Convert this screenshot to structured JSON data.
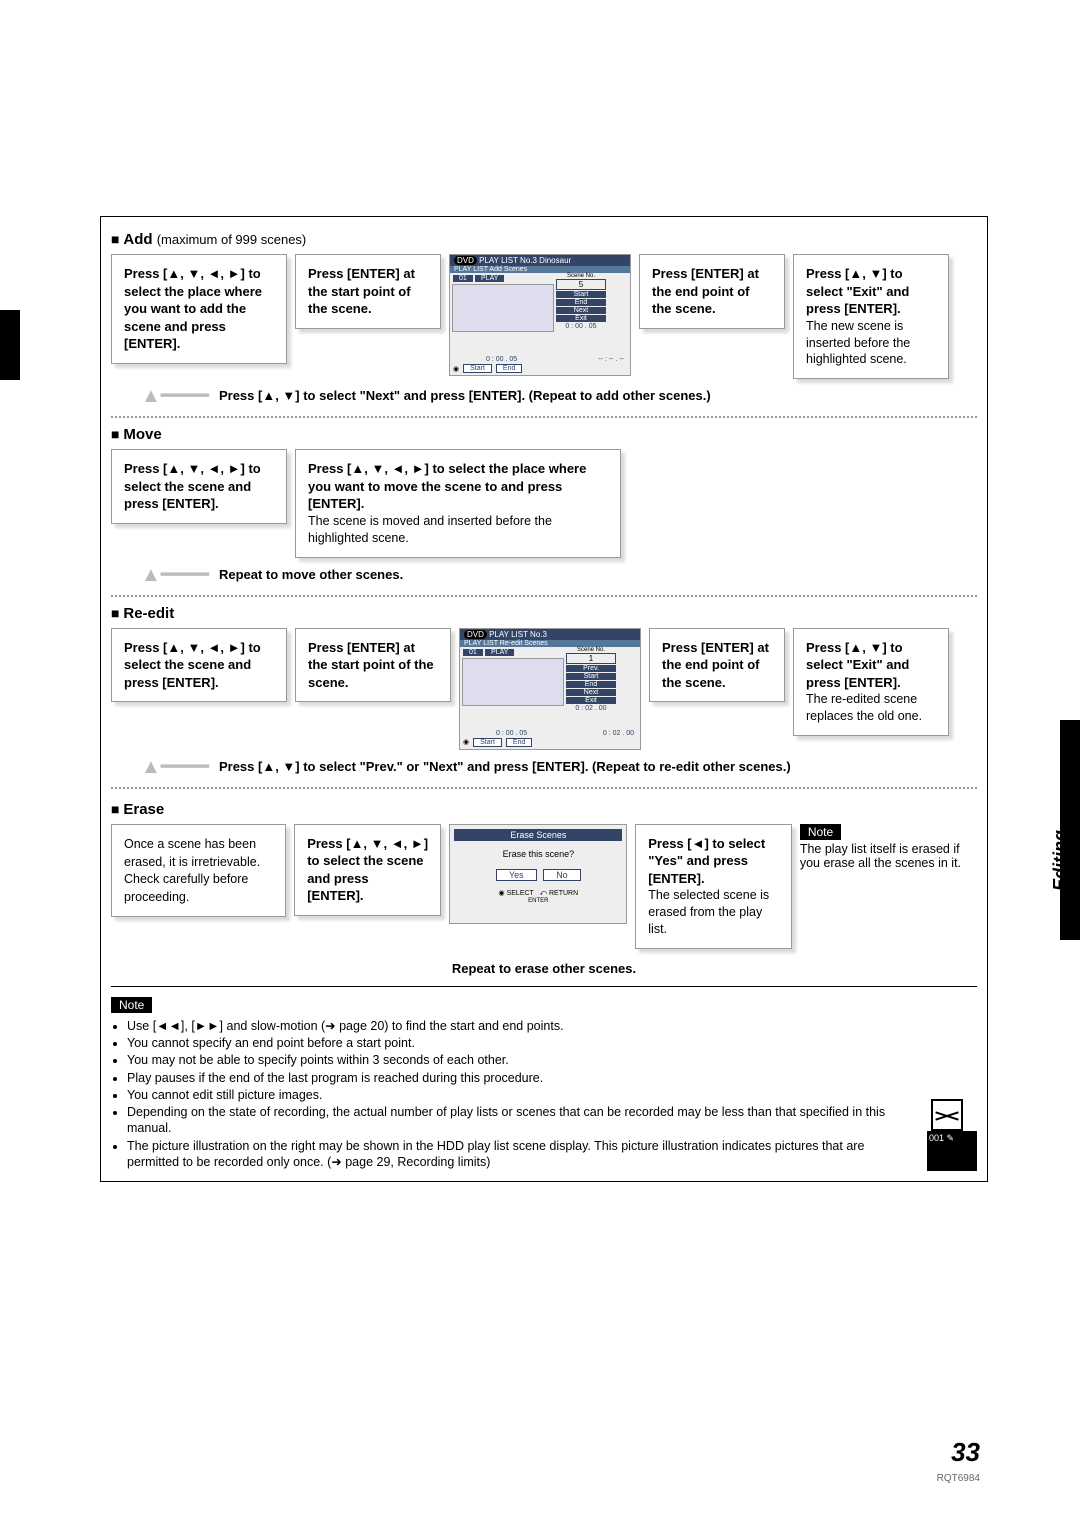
{
  "sideLabel": "Editing",
  "pageNumber": "33",
  "docCode": "RQT6984",
  "add": {
    "title": "Add",
    "subtitle": "(maximum of 999 scenes)",
    "step1": "Press [▲, ▼, ◄, ►] to select the place where you want to add the scene and press [ENTER].",
    "step2": "Press [ENTER] at the start point of the scene.",
    "step3": "Press [ENTER] at the end point of the scene.",
    "step4a": "Press [▲, ▼] to select \"Exit\" and press [ENTER].",
    "step4b": "The new scene is inserted before the highlighted scene.",
    "loopText": "Press [▲, ▼] to select \"Next\" and press [ENTER]. (Repeat to add other scenes.)",
    "screen": {
      "dvd": "DVD",
      "title": "PLAY LIST No.3 Dinosaur",
      "sub": "PLAY LIST Add Scenes",
      "chapter": "01",
      "play": "PLAY",
      "sceneNoLabel": "Scene No.",
      "sceneNo": "5",
      "menu": [
        "Start",
        "End",
        "Next",
        "Exit"
      ],
      "time1": "0 : 00 . 05",
      "startBtn": "Start",
      "endBtn": "End",
      "time2": "0 : 00 . 05",
      "timeR": "-- : -- . --"
    }
  },
  "move": {
    "title": "Move",
    "step1": "Press [▲, ▼, ◄, ►] to select the scene and press [ENTER].",
    "step2a": "Press [▲, ▼, ◄, ►] to select the place where you want to move the scene to and press [ENTER].",
    "step2b": "The scene is moved and inserted before the highlighted scene.",
    "loopText": "Repeat to move other scenes."
  },
  "reedit": {
    "title": "Re-edit",
    "step1": "Press [▲, ▼, ◄, ►] to select the scene and press [ENTER].",
    "step2": "Press [ENTER] at the start point of the scene.",
    "step3": "Press [ENTER] at the end point of the scene.",
    "step4a": "Press [▲, ▼] to select \"Exit\" and press [ENTER].",
    "step4b": "The re-edited scene replaces the old one.",
    "loopText": "Press [▲, ▼] to select \"Prev.\" or \"Next\" and press [ENTER]. (Repeat to re-edit other scenes.)",
    "screen": {
      "dvd": "DVD",
      "title": "PLAY LIST No.3",
      "sub": "PLAY LIST Re-edit Scenes",
      "chapter": "01",
      "play": "PLAY",
      "sceneNoLabel": "Scene No.",
      "sceneNo": "1",
      "menu": [
        "Prev.",
        "Start",
        "End",
        "Next",
        "Exit"
      ],
      "time1": "0 : 02 . 00",
      "startBtn": "Start",
      "endBtn": "End",
      "time2": "0 : 00 . 05",
      "timeR": "0 : 02 . 00"
    }
  },
  "erase": {
    "title": "Erase",
    "warn": "Once a scene has been erased, it is irretrievable. Check carefully before proceeding.",
    "step1": "Press [▲, ▼, ◄, ►] to select the scene and press [ENTER].",
    "step2a": "Press [◄] to select \"Yes\" and press [ENTER].",
    "step2b": "The selected scene is erased from the play list.",
    "loopText": "Repeat to erase other scenes.",
    "noteLabel": "Note",
    "noteText": "The play list itself is erased if you erase all the scenes in it.",
    "dialog": {
      "title": "Erase Scenes",
      "msg": "Erase this scene?",
      "yes": "Yes",
      "no": "No",
      "foot1": "SELECT",
      "foot2": "RETURN",
      "foot0": "ENTER"
    }
  },
  "notes": {
    "label": "Note",
    "items": [
      "Use [◄◄], [►►] and slow-motion (➜ page 20) to find the start and end points.",
      "You cannot specify an end point before a start point.",
      "You may not be able to specify points within 3 seconds of each other.",
      "Play pauses if the end of the last program is reached during this procedure.",
      "You cannot edit still picture images.",
      "Depending on the state of recording, the actual number of play lists or scenes that can be recorded may be less than that specified in this manual.",
      "The picture illustration on the right may be shown in the HDD play list scene display. This picture illustration indicates pictures that are permitted to be recorded only once. (➜ page 29, Recording limits)"
    ],
    "illusNum": "001"
  }
}
